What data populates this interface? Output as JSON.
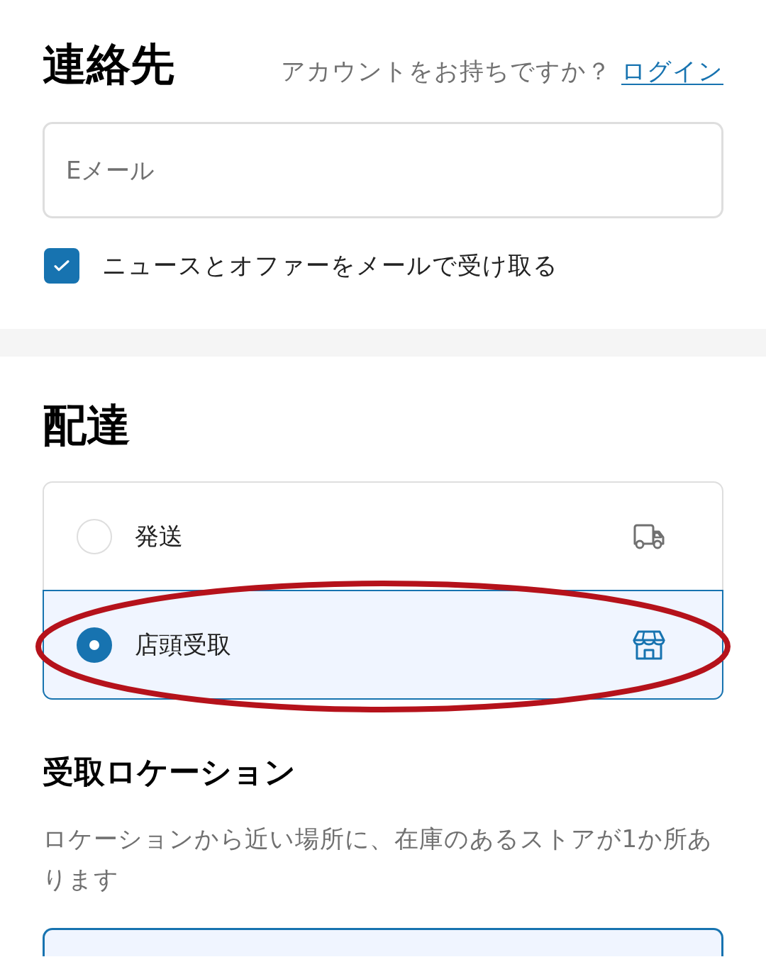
{
  "contact": {
    "title": "連絡先",
    "login_prompt": "アカウントをお持ちですか？",
    "login_link": "ログイン",
    "email": {
      "placeholder": "Eメール"
    },
    "newsletter": {
      "label": "ニュースとオファーをメールで受け取る",
      "checked": true
    }
  },
  "delivery": {
    "title": "配達",
    "options": [
      {
        "label": "発送",
        "kind": "ship",
        "selected": false,
        "highlighted": false
      },
      {
        "label": "店頭受取",
        "kind": "pickup",
        "selected": true,
        "highlighted": true
      }
    ]
  },
  "pickup_location": {
    "title": "受取ロケーション",
    "description": "ロケーションから近い場所に、在庫のあるストアが1か所あります"
  }
}
